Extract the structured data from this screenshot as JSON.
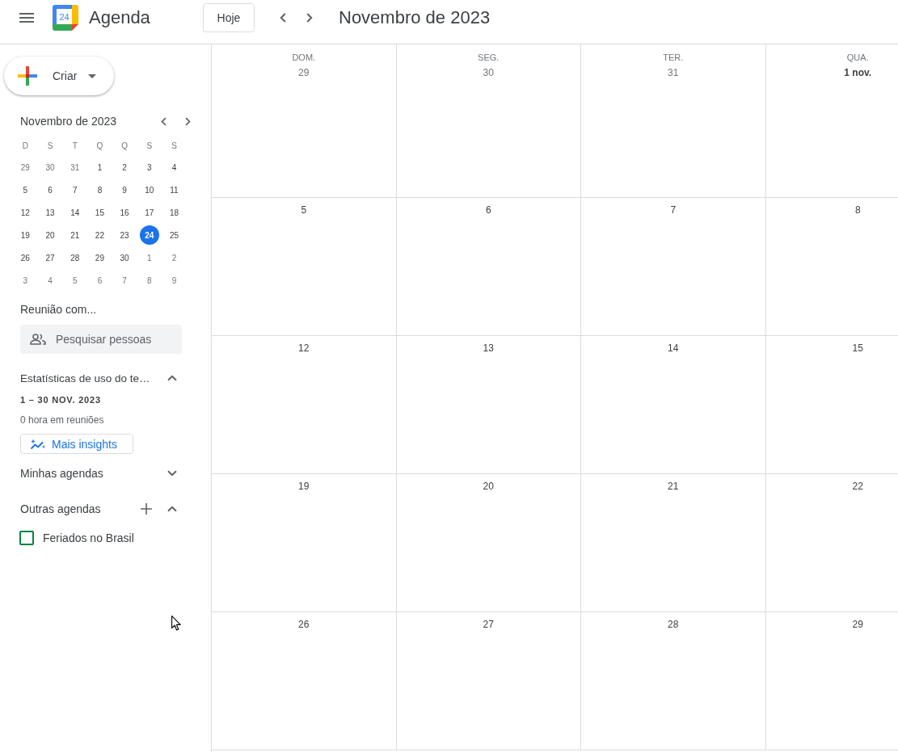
{
  "header": {
    "logo_text": "24",
    "app_name": "Agenda",
    "today_button": "Hoje",
    "title": "Novembro de 2023"
  },
  "sidebar": {
    "create_button": "Criar",
    "mini_calendar": {
      "title": "Novembro de 2023",
      "weekdays": [
        "D",
        "S",
        "T",
        "Q",
        "Q",
        "S",
        "S"
      ],
      "days": [
        {
          "day": "29",
          "in_month": false,
          "selected": false
        },
        {
          "day": "30",
          "in_month": false,
          "selected": false
        },
        {
          "day": "31",
          "in_month": false,
          "selected": false
        },
        {
          "day": "1",
          "in_month": true,
          "selected": false
        },
        {
          "day": "2",
          "in_month": true,
          "selected": false
        },
        {
          "day": "3",
          "in_month": true,
          "selected": false
        },
        {
          "day": "4",
          "in_month": true,
          "selected": false
        },
        {
          "day": "5",
          "in_month": true,
          "selected": false
        },
        {
          "day": "6",
          "in_month": true,
          "selected": false
        },
        {
          "day": "7",
          "in_month": true,
          "selected": false
        },
        {
          "day": "8",
          "in_month": true,
          "selected": false
        },
        {
          "day": "9",
          "in_month": true,
          "selected": false
        },
        {
          "day": "10",
          "in_month": true,
          "selected": false
        },
        {
          "day": "11",
          "in_month": true,
          "selected": false
        },
        {
          "day": "12",
          "in_month": true,
          "selected": false
        },
        {
          "day": "13",
          "in_month": true,
          "selected": false
        },
        {
          "day": "14",
          "in_month": true,
          "selected": false
        },
        {
          "day": "15",
          "in_month": true,
          "selected": false
        },
        {
          "day": "16",
          "in_month": true,
          "selected": false
        },
        {
          "day": "17",
          "in_month": true,
          "selected": false
        },
        {
          "day": "18",
          "in_month": true,
          "selected": false
        },
        {
          "day": "19",
          "in_month": true,
          "selected": false
        },
        {
          "day": "20",
          "in_month": true,
          "selected": false
        },
        {
          "day": "21",
          "in_month": true,
          "selected": false
        },
        {
          "day": "22",
          "in_month": true,
          "selected": false
        },
        {
          "day": "23",
          "in_month": true,
          "selected": false
        },
        {
          "day": "24",
          "in_month": true,
          "selected": true
        },
        {
          "day": "25",
          "in_month": true,
          "selected": false
        },
        {
          "day": "26",
          "in_month": true,
          "selected": false
        },
        {
          "day": "27",
          "in_month": true,
          "selected": false
        },
        {
          "day": "28",
          "in_month": true,
          "selected": false
        },
        {
          "day": "29",
          "in_month": true,
          "selected": false
        },
        {
          "day": "30",
          "in_month": true,
          "selected": false
        },
        {
          "day": "1",
          "in_month": false,
          "selected": false
        },
        {
          "day": "2",
          "in_month": false,
          "selected": false
        },
        {
          "day": "3",
          "in_month": false,
          "selected": false
        },
        {
          "day": "4",
          "in_month": false,
          "selected": false
        },
        {
          "day": "5",
          "in_month": false,
          "selected": false
        },
        {
          "day": "6",
          "in_month": false,
          "selected": false
        },
        {
          "day": "7",
          "in_month": false,
          "selected": false
        },
        {
          "day": "8",
          "in_month": false,
          "selected": false
        },
        {
          "day": "9",
          "in_month": false,
          "selected": false
        }
      ]
    },
    "meet_with": {
      "title": "Reunião com...",
      "search": {
        "placeholder": "Pesquisar pessoas"
      }
    },
    "time_insights": {
      "title": "Estatísticas de uso do te…",
      "expanded": true,
      "range": "1 – 30 NOV. 2023",
      "summary": "0 hora em reuniões",
      "button": "Mais insights"
    },
    "my_calendars": {
      "title": "Minhas agendas",
      "expanded": false
    },
    "other_calendars": {
      "title": "Outras agendas",
      "expanded": true,
      "calendars": [
        {
          "label": "Feriados no Brasil",
          "checked": false,
          "color": "#0b8043"
        }
      ]
    }
  },
  "month_grid": {
    "weekdays": [
      "DOM.",
      "SEG.",
      "TER.",
      "QUA."
    ],
    "weeks": [
      [
        {
          "date": "29",
          "kind": "outside"
        },
        {
          "date": "30",
          "kind": "outside"
        },
        {
          "date": "31",
          "kind": "outside"
        },
        {
          "date": "1 nov.",
          "kind": "month_start"
        }
      ],
      [
        {
          "date": "5",
          "kind": "normal"
        },
        {
          "date": "6",
          "kind": "normal"
        },
        {
          "date": "7",
          "kind": "normal"
        },
        {
          "date": "8",
          "kind": "normal"
        }
      ],
      [
        {
          "date": "12",
          "kind": "normal"
        },
        {
          "date": "13",
          "kind": "normal"
        },
        {
          "date": "14",
          "kind": "normal"
        },
        {
          "date": "15",
          "kind": "normal"
        }
      ],
      [
        {
          "date": "19",
          "kind": "normal"
        },
        {
          "date": "20",
          "kind": "normal"
        },
        {
          "date": "21",
          "kind": "normal"
        },
        {
          "date": "22",
          "kind": "normal"
        }
      ],
      [
        {
          "date": "26",
          "kind": "normal"
        },
        {
          "date": "27",
          "kind": "normal"
        },
        {
          "date": "28",
          "kind": "normal"
        },
        {
          "date": "29",
          "kind": "normal"
        }
      ]
    ]
  }
}
